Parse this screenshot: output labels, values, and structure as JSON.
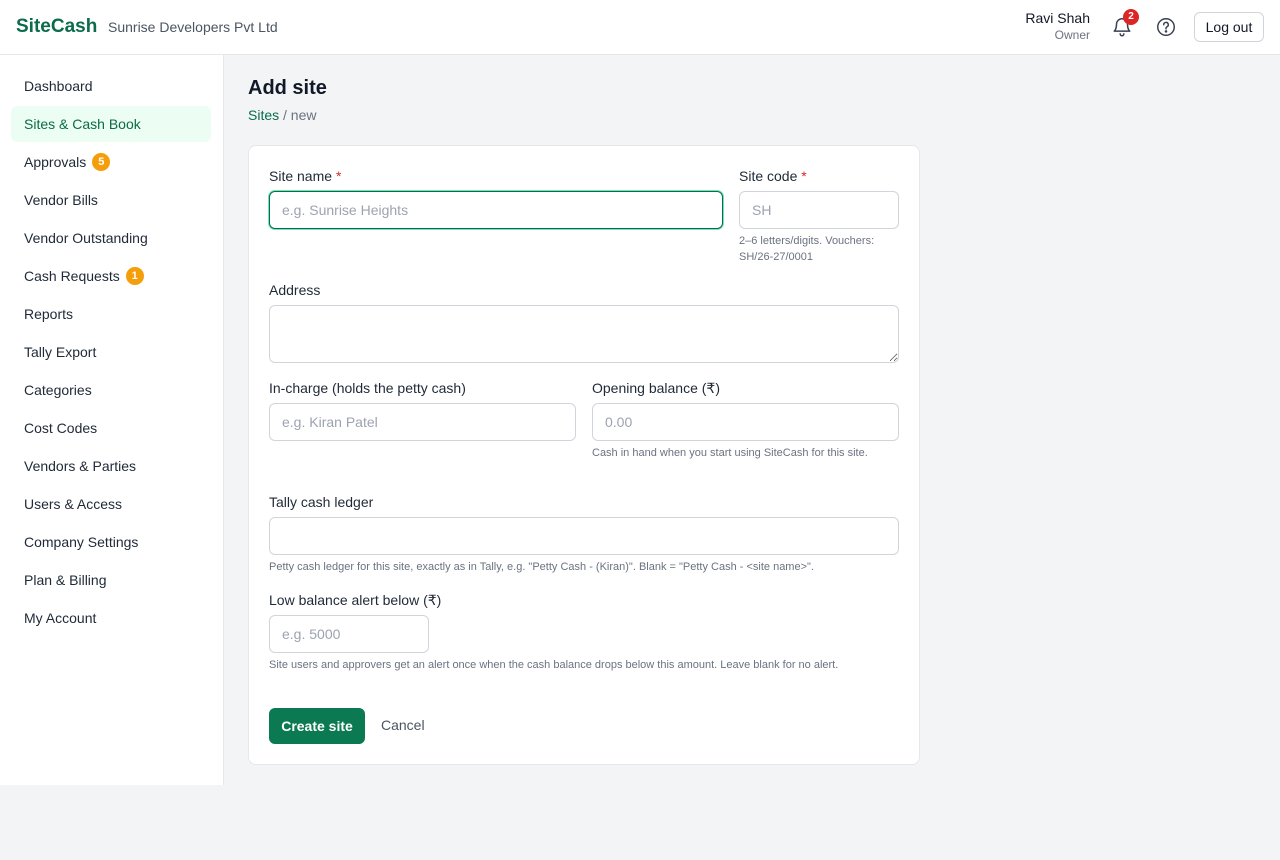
{
  "header": {
    "brand": "SiteCash",
    "company": "Sunrise Developers Pvt Ltd",
    "user_name": "Ravi Shah",
    "user_role": "Owner",
    "notifications_count": "2",
    "logout_label": "Log out"
  },
  "sidebar": {
    "items": [
      {
        "label": "Dashboard",
        "badge": ""
      },
      {
        "label": "Sites & Cash Book",
        "badge": ""
      },
      {
        "label": "Approvals",
        "badge": "5"
      },
      {
        "label": "Vendor Bills",
        "badge": ""
      },
      {
        "label": "Vendor Outstanding",
        "badge": ""
      },
      {
        "label": "Cash Requests",
        "badge": "1"
      },
      {
        "label": "Reports",
        "badge": ""
      },
      {
        "label": "Tally Export",
        "badge": ""
      },
      {
        "label": "Categories",
        "badge": ""
      },
      {
        "label": "Cost Codes",
        "badge": ""
      },
      {
        "label": "Vendors & Parties",
        "badge": ""
      },
      {
        "label": "Users & Access",
        "badge": ""
      },
      {
        "label": "Company Settings",
        "badge": ""
      },
      {
        "label": "Plan & Billing",
        "badge": ""
      },
      {
        "label": "My Account",
        "badge": ""
      }
    ],
    "active_index": 1
  },
  "page": {
    "title": "Add site",
    "breadcrumb_link": "Sites",
    "breadcrumb_sep": "/",
    "breadcrumb_current": "new"
  },
  "form": {
    "site_name": {
      "label": "Site name",
      "required_mark": "*",
      "placeholder": "e.g. Sunrise Heights",
      "value": ""
    },
    "site_code": {
      "label": "Site code",
      "required_mark": "*",
      "placeholder": "SH",
      "value": "",
      "hint": "2–6 letters/digits. Vouchers: SH/26-27/0001"
    },
    "address": {
      "label": "Address",
      "value": ""
    },
    "in_charge": {
      "label": "In-charge (holds the petty cash)",
      "placeholder": "e.g. Kiran Patel",
      "value": ""
    },
    "opening_balance": {
      "label": "Opening balance (₹)",
      "placeholder": "0.00",
      "value": "",
      "hint": "Cash in hand when you start using SiteCash for this site."
    },
    "tally_ledger": {
      "label": "Tally cash ledger",
      "value": "",
      "hint": "Petty cash ledger for this site, exactly as in Tally, e.g. \"Petty Cash - (Kiran)\". Blank = \"Petty Cash - <site name>\"."
    },
    "low_balance": {
      "label": "Low balance alert below (₹)",
      "placeholder": "e.g. 5000",
      "value": "",
      "hint": "Site users and approvers get an alert once when the cash balance drops below this amount. Leave blank for no alert."
    },
    "submit_label": "Create site",
    "cancel_label": "Cancel"
  },
  "colors": {
    "brand": "#0b6b4a",
    "primary_button": "#0b7a52",
    "badge_orange": "#f59e0b",
    "badge_red": "#dc2626",
    "active_nav_bg": "#ecfdf3"
  }
}
